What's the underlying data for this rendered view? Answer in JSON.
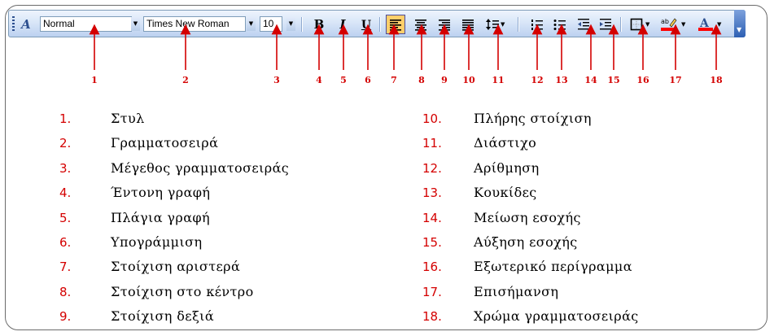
{
  "toolbar": {
    "style_value": "Normal",
    "font_value": "Times New Roman",
    "size_value": "10",
    "bold_glyph": "B",
    "italic_glyph": "I",
    "underline_glyph": "U",
    "style_icon_glyph": "A",
    "highlight_color": "#ff0000",
    "font_color": "#ff0000",
    "selected_button": "align-left"
  },
  "callout_numbers": [
    "1",
    "2",
    "3",
    "4",
    "5",
    "6",
    "7",
    "8",
    "9",
    "10",
    "11",
    "12",
    "13",
    "14",
    "15",
    "16",
    "17",
    "18"
  ],
  "legend": {
    "left": [
      {
        "num": "1.",
        "text": "Στυλ"
      },
      {
        "num": "2.",
        "text": "Γραμματοσειρά"
      },
      {
        "num": "3.",
        "text": "Μέγεθος γραμματοσειράς"
      },
      {
        "num": "4.",
        "text": "Έντονη γραφή"
      },
      {
        "num": "5.",
        "text": "Πλάγια γραφή"
      },
      {
        "num": "6.",
        "text": "Υπογράμμιση"
      },
      {
        "num": "7.",
        "text": "Στοίχιση αριστερά"
      },
      {
        "num": "8.",
        "text": "Στοίχιση στο κέντρο"
      },
      {
        "num": "9.",
        "text": "Στοίχιση δεξιά"
      }
    ],
    "right": [
      {
        "num": "10.",
        "text": "Πλήρης στοίχιση"
      },
      {
        "num": "11.",
        "text": "Διάστιχο"
      },
      {
        "num": "12.",
        "text": "Αρίθμηση"
      },
      {
        "num": "13.",
        "text": "Κουκίδες"
      },
      {
        "num": "14.",
        "text": "Μείωση εσοχής"
      },
      {
        "num": "15.",
        "text": "Αύξηση εσοχής"
      },
      {
        "num": "16.",
        "text": "Εξωτερικό περίγραμμα"
      },
      {
        "num": "17.",
        "text": "Επισήμανση"
      },
      {
        "num": "18.",
        "text": "Χρώμα γραμματοσειράς"
      }
    ]
  },
  "colors": {
    "callout": "#d40000",
    "toolbar_accent": "#2d4f8f"
  }
}
